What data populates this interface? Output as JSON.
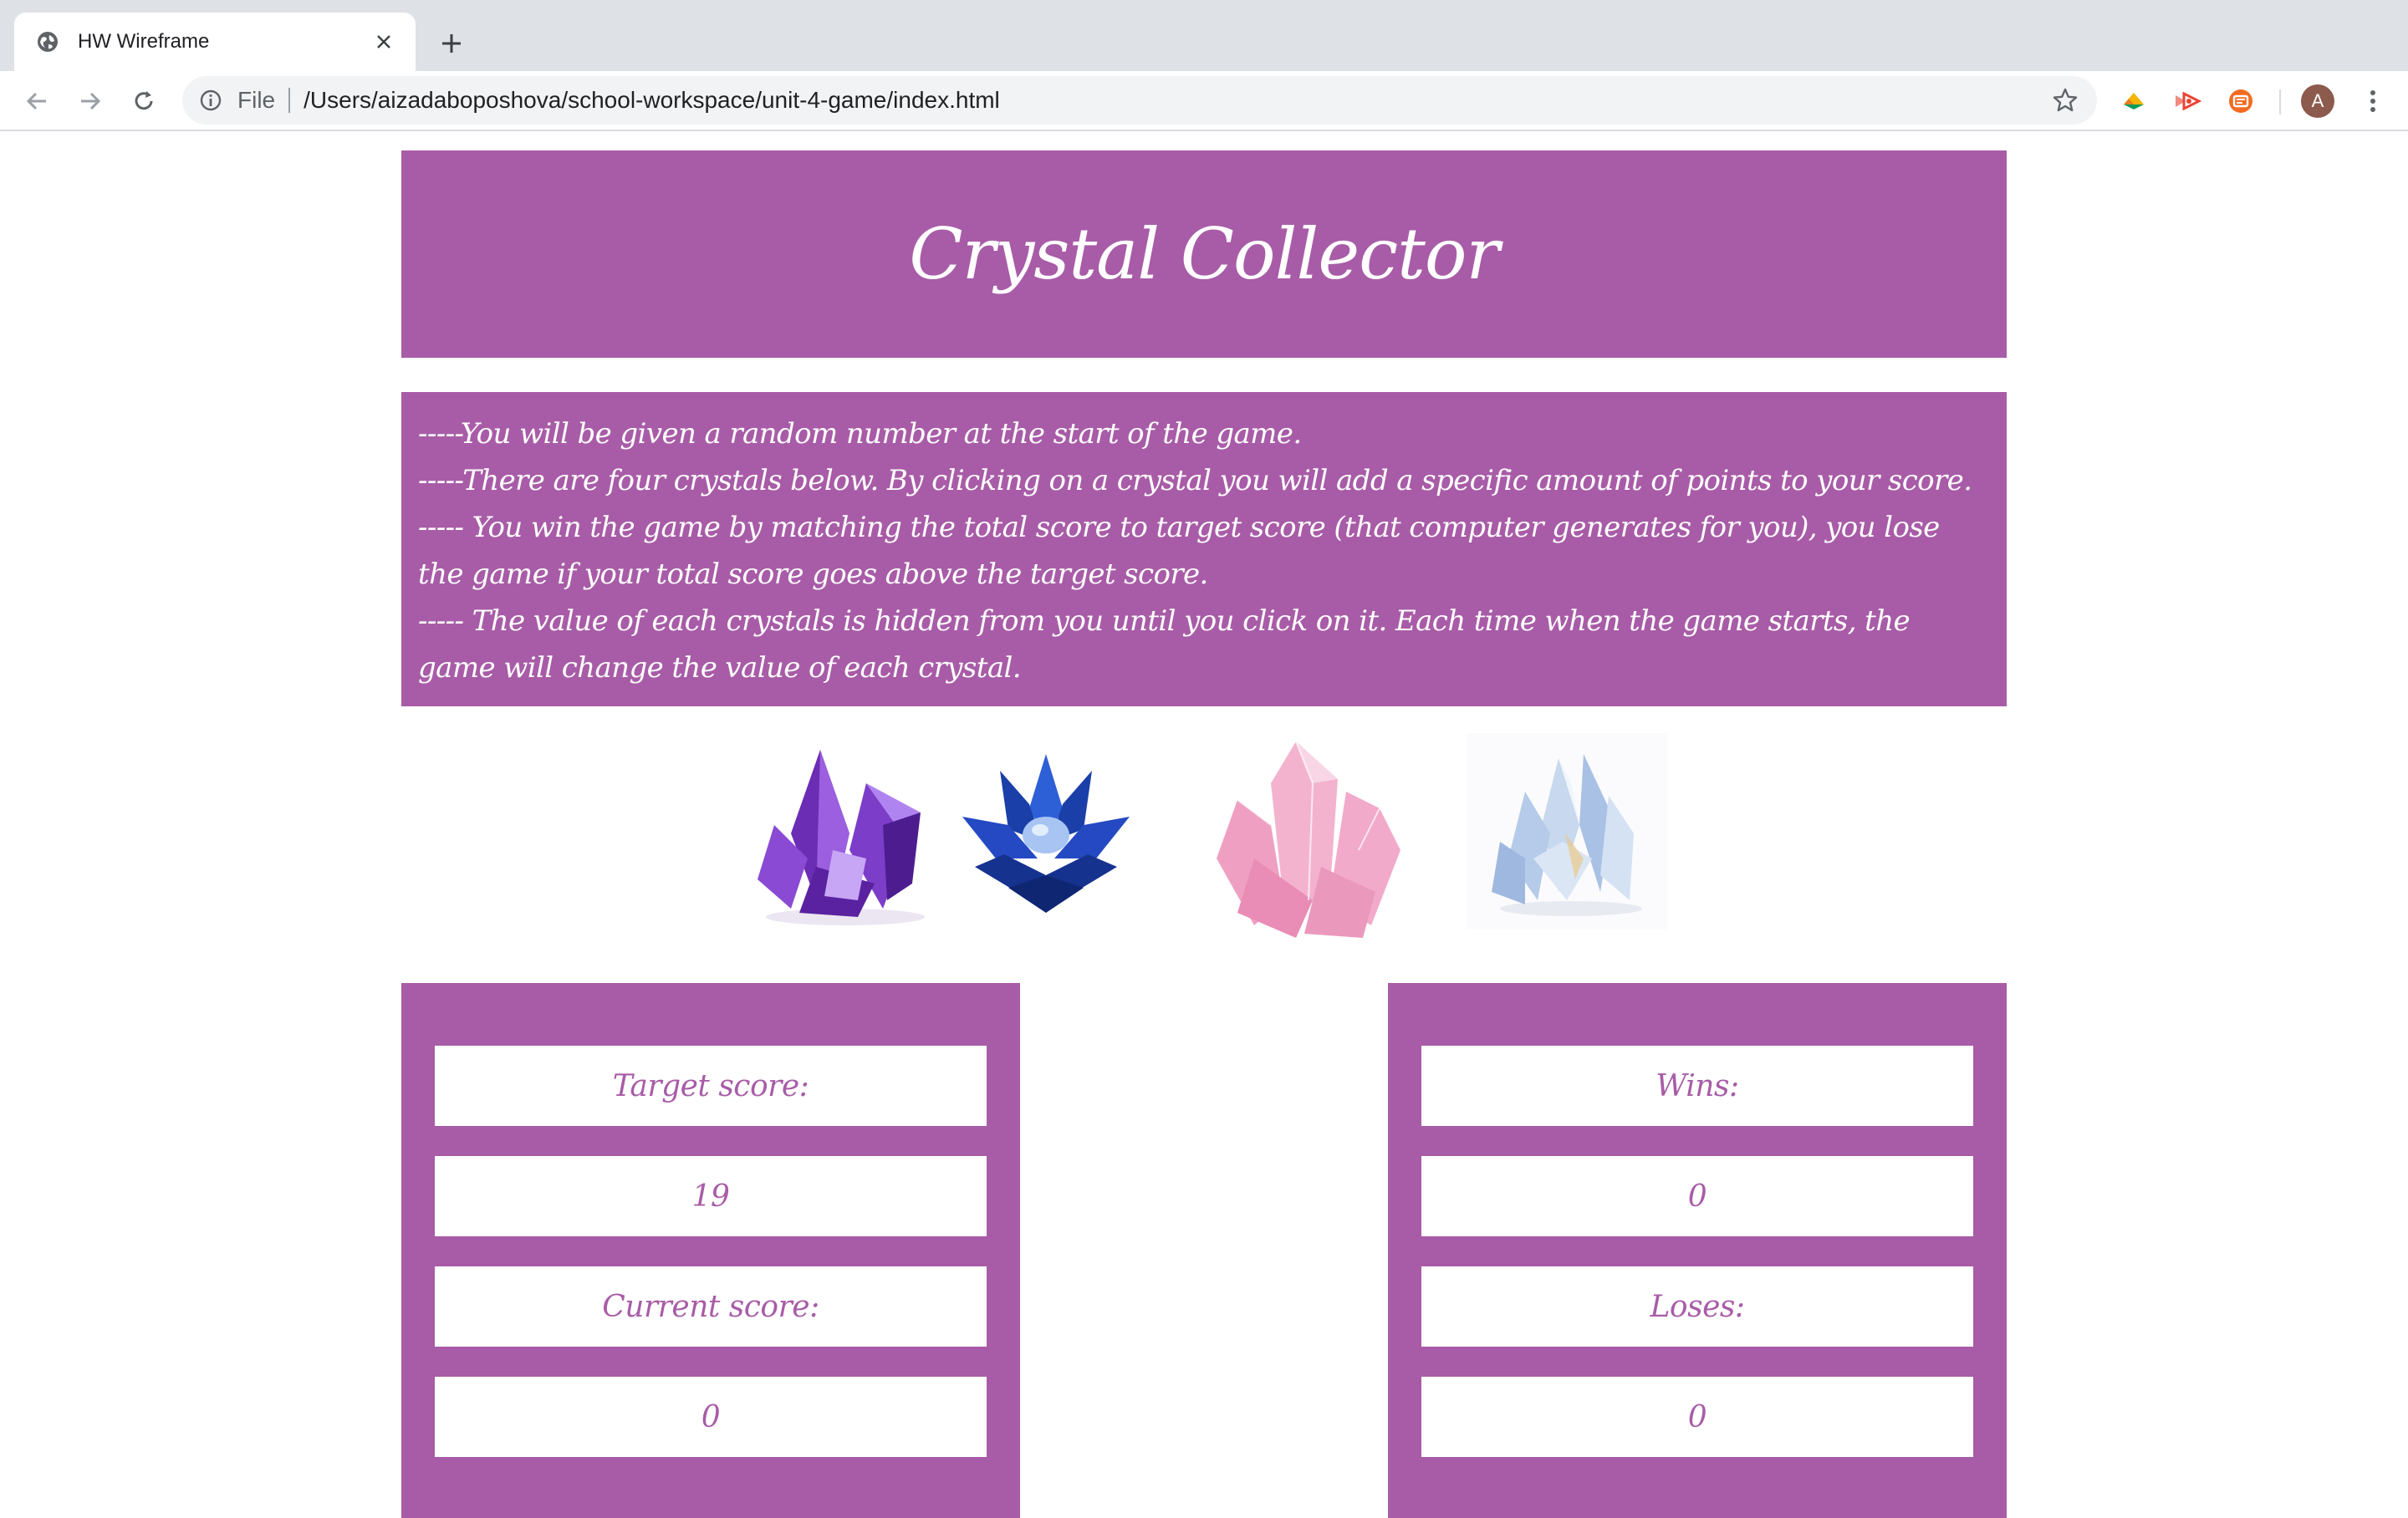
{
  "browser": {
    "tab_title": "HW Wireframe",
    "url_scheme_label": "File",
    "url": "/Users/aizadaboposhova/school-workspace/unit-4-game/index.html",
    "avatar_initial": "A"
  },
  "page": {
    "title": "Crystal Collector",
    "instructions": [
      "-----You will be given a random number at the start of the game.",
      "-----There are four crystals below. By clicking on a crystal you will add a specific amount of points to your score.",
      "----- You win the game by matching the total score to target score (that computer generates for you), you lose the game if your total score goes above the target score.",
      "----- The value of each crystals is hidden from you until you click on it. Each time when the game starts, the game will change the value of each crystal."
    ],
    "crystals": [
      {
        "name": "purple crystal",
        "color": "#7b3fc4"
      },
      {
        "name": "blue lotus crystal",
        "color": "#1f3fb0"
      },
      {
        "name": "pink crystal",
        "color": "#f2a9c9"
      },
      {
        "name": "clear blue crystal",
        "color": "#b8cfe8"
      }
    ],
    "left_panel": {
      "target_label": "Target score:",
      "target_value": "19",
      "current_label": "Current score:",
      "current_value": "0"
    },
    "right_panel": {
      "wins_label": "Wins:",
      "wins_value": "0",
      "losses_label": "Loses:",
      "losses_value": "0"
    }
  },
  "colors": {
    "accent_purple": "#a85ca7",
    "chrome_bg": "#dee1e6"
  }
}
